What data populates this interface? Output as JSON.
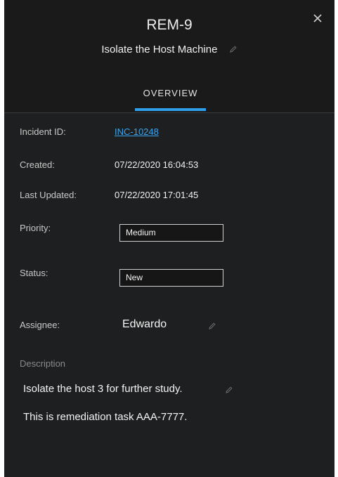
{
  "header": {
    "id": "REM-9",
    "title": "Isolate the Host Machine"
  },
  "tabs": [
    {
      "label": "OVERVIEW",
      "active": true
    }
  ],
  "fields": {
    "incident_id": {
      "label": "Incident ID:",
      "value": "INC-10248"
    },
    "created": {
      "label": "Created:",
      "value": "07/22/2020 16:04:53"
    },
    "last_updated": {
      "label": "Last Updated:",
      "value": "07/22/2020 17:01:45"
    },
    "priority": {
      "label": "Priority:",
      "value": "Medium"
    },
    "status": {
      "label": "Status:",
      "value": "New"
    },
    "assignee": {
      "label": "Assignee:",
      "value": "Edwardo"
    }
  },
  "description": {
    "label": "Description",
    "lines": [
      "Isolate the host 3 for further study.",
      "This is remediation task AAA-7777."
    ]
  },
  "colors": {
    "panel_bg": "#1e1f20",
    "header_bg": "#1a1a1b",
    "accent": "#2f9ee8",
    "link": "#3aa6f0"
  },
  "icons": {
    "close": "close-icon",
    "edit": "pencil-icon"
  }
}
